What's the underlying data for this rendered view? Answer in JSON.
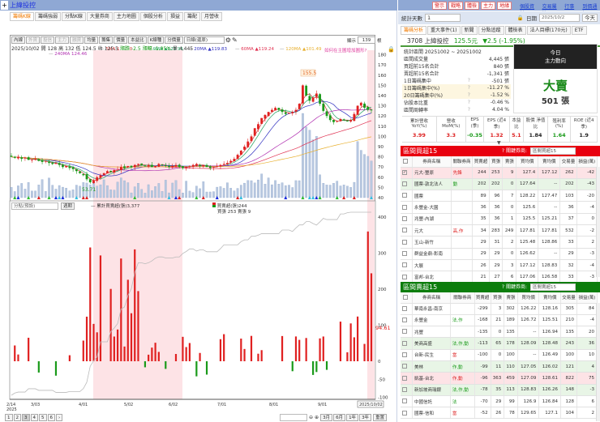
{
  "left": {
    "title": "上緯投控",
    "plus": "+",
    "tabs": [
      "籌碼K線",
      "籌碼強弱",
      "分點K線",
      "大量券商",
      "主力地圖",
      "個股分析",
      "損益",
      "籌配",
      "月營收"
    ],
    "ma": [
      {
        "label": "5MA 130.20",
        "color": "#d03030"
      },
      {
        "label": "10MA ▲123.95",
        "color": "#20a060"
      },
      {
        "label": "20MA ▲119.83",
        "color": "#3030c0"
      },
      {
        "label": "60MA ▲119.24",
        "color": "#e03050"
      },
      {
        "label": "120MA ▲101.49",
        "color": "#e8b030"
      },
      {
        "label": "240MA 124.46",
        "color": "#b030b0"
      }
    ],
    "ma_help": "如何在主圖增加圖形?",
    "toolbar": [
      "內線",
      "外資",
      "投信",
      "主力",
      "融資",
      "均量",
      "籌集",
      "價量",
      "本益比",
      "K線種",
      "分價量"
    ],
    "period_select": "日線(還原)",
    "show_label": "顯示",
    "show_count": "139",
    "show_unit": "根",
    "info": {
      "date": "2025/10/02",
      "open_l": "開",
      "open": "128",
      "high_l": "高",
      "high": "132",
      "low_l": "低",
      "low": "124.5",
      "close_l": "收",
      "close": "125.5",
      "chg_l": "漲跌",
      "chg": "-2.5",
      "pct_l": "漲幅",
      "pct": "-1.95%",
      "vol_l": "量",
      "vol": "4,445"
    },
    "lower": {
      "select": "分點(預設)",
      "button": "週期",
      "cum_legend": "累計買賣超(張)3,377",
      "net_legend": "買賣超(張)244",
      "bs_legend": "買張 253 賣張 9",
      "value_tag": "94.61"
    },
    "xaxis": [
      "2/14",
      "2025",
      "3/03",
      "4/01",
      "5/02",
      "6/02",
      "7/01",
      "8/01",
      "9/01",
      "2025/10/02"
    ],
    "pages": [
      "1",
      "2",
      "3",
      "4",
      "5",
      "6",
      "›"
    ],
    "range_buttons": [
      "3月",
      "6月",
      "1年",
      "3年"
    ],
    "reset": "重置"
  },
  "chart_data": {
    "type": "candlestick",
    "price_ticks": [
      180,
      170,
      160,
      150,
      140,
      130,
      120,
      110,
      100,
      90,
      80,
      70,
      60,
      50,
      40
    ],
    "flow_ticks": [
      400,
      300,
      200,
      100,
      0,
      -50,
      -100
    ],
    "close": [
      80,
      79,
      80,
      78,
      79,
      77,
      77,
      78,
      76,
      75,
      76,
      74,
      73,
      74,
      72,
      70,
      71,
      69,
      68,
      66,
      64,
      62,
      58,
      55,
      57,
      60,
      62,
      64,
      66,
      65,
      67,
      68,
      70,
      69,
      71,
      70,
      72,
      73,
      72,
      71,
      72,
      70,
      71,
      73,
      72,
      71,
      70,
      71,
      72,
      70,
      69,
      70,
      71,
      72,
      73,
      71,
      72,
      70,
      69,
      70,
      71,
      72,
      73,
      74,
      76,
      78,
      82,
      86,
      90,
      95,
      100,
      108,
      112,
      118,
      121,
      124,
      126,
      128,
      126,
      124,
      122,
      123,
      124,
      126,
      132,
      150,
      140,
      135,
      138,
      142,
      132,
      125,
      120,
      116,
      114,
      115,
      117,
      116,
      115,
      116,
      122,
      130,
      133,
      128,
      126,
      125.5
    ],
    "low_label": "53.71",
    "high_label": "155.5"
  },
  "right": {
    "top_buttons": [
      "警示",
      "戰略",
      "體檢",
      "主力",
      "地緣"
    ],
    "top_links": [
      "個股資料",
      "交易屬性",
      "行事曆",
      "到價通知"
    ],
    "days_label": "統計天數",
    "days_value": "1",
    "date_label": "日期",
    "date_value": "2025/10/2",
    "today": "今天",
    "tabs": [
      "籌碼分析",
      "重大事件(1)",
      "新聞",
      "分點追蹤",
      "體檢表",
      "法人目標(170元)",
      "ETF"
    ],
    "stock": {
      "code_name": "3708 上緯投控",
      "price": "125.5元",
      "change": "▼2.5 (-1.95%)"
    },
    "stats": [
      [
        "統計區間  20251002 ~ 20251002",
        "",
        ""
      ],
      [
        "區間成交量",
        "4,445 張",
        ""
      ],
      [
        "買超前15名合計",
        "840 張",
        ""
      ],
      [
        "賣超前15名合計",
        "-1,341 張",
        ""
      ],
      [
        "1日籌碼集中",
        "-501 張",
        "?"
      ],
      [
        "1日籌碼集中(%)",
        "-11.27 %",
        "?"
      ],
      [
        "20日籌碼集中(%)",
        "-1.52 %",
        "?"
      ],
      [
        "佔股本比重",
        "-0.46 %",
        "?"
      ],
      [
        "區間周轉率",
        "4.04 %",
        "?"
      ]
    ],
    "today_box": {
      "l1": "今日",
      "l2": "主力動向",
      "action": "大賣",
      "amount": "501 張"
    },
    "fin_headers": [
      "累計營收 YoY(%)",
      "營收 MoM(%)",
      "EPS (季)",
      "EPS (近4季)",
      "本益比",
      "股價 淨值比",
      "殖利率 (%)",
      "ROE (近4季)"
    ],
    "fin_values": [
      {
        "v": "3.99",
        "c": "#d22"
      },
      {
        "v": "3.3",
        "c": "#d22"
      },
      {
        "v": "-0.35",
        "c": "#1a9a1a"
      },
      {
        "v": "1.32",
        "c": "#d22"
      },
      {
        "v": "5.1",
        "c": "#d22"
      },
      {
        "v": "1.84",
        "c": "#222"
      },
      {
        "v": "1.64",
        "c": "#1a9a1a"
      },
      {
        "v": "1.9",
        "c": "#222"
      }
    ],
    "col_headers": [
      "券商名稱",
      "關聯券商",
      "買賣超",
      "買張",
      "賣張",
      "買均價",
      "賣均價",
      "交易量",
      "損益(萬)"
    ],
    "buy": {
      "title": "區間買超15",
      "filter_label": "關鍵券商:",
      "filter": "區間買超15",
      "rows": [
        {
          "n": "元大-豐原",
          "t": "先鋒",
          "tc": "#d22",
          "v": [
            "244",
            "253",
            "9",
            "127.4",
            "127.12",
            "262",
            "-42"
          ],
          "cls": "tr-pink",
          "checked": "✓"
        },
        {
          "n": "國票-敦北法人",
          "t": "動",
          "tc": "#1a9a1a",
          "v": [
            "202",
            "202",
            "0",
            "127.64",
            "--",
            "202",
            "-43"
          ],
          "cls": "tr-green",
          "checked": ""
        },
        {
          "n": "國票",
          "t": "",
          "tc": "",
          "v": [
            "89",
            "96",
            "7",
            "128.22",
            "127.47",
            "103",
            "-20"
          ],
          "cls": "",
          "checked": ""
        },
        {
          "n": "永豐金-大園",
          "t": "",
          "tc": "",
          "v": [
            "36",
            "36",
            "0",
            "125.6",
            "--",
            "36",
            "-4"
          ],
          "cls": "",
          "checked": ""
        },
        {
          "n": "兆豐-內湖",
          "t": "",
          "tc": "",
          "v": [
            "35",
            "36",
            "1",
            "125.5",
            "125.21",
            "37",
            "0"
          ],
          "cls": "",
          "checked": ""
        },
        {
          "n": "元大",
          "t": "高,作",
          "tc": "#d22",
          "v": [
            "34",
            "283",
            "249",
            "127.81",
            "127.81",
            "532",
            "-2"
          ],
          "cls": "",
          "checked": ""
        },
        {
          "n": "玉山-新竹",
          "t": "",
          "tc": "",
          "v": [
            "29",
            "31",
            "2",
            "125.48",
            "128.86",
            "33",
            "2"
          ],
          "cls": "",
          "checked": ""
        },
        {
          "n": "群益金鼎-彰南",
          "t": "",
          "tc": "",
          "v": [
            "29",
            "29",
            "0",
            "126.62",
            "--",
            "29",
            "-3"
          ],
          "cls": "",
          "checked": ""
        },
        {
          "n": "大展",
          "t": "",
          "tc": "",
          "v": [
            "26",
            "29",
            "3",
            "127.12",
            "128.83",
            "32",
            "-4"
          ],
          "cls": "",
          "checked": ""
        },
        {
          "n": "富邦-台北",
          "t": "",
          "tc": "",
          "v": [
            "21",
            "27",
            "6",
            "127.06",
            "126.58",
            "33",
            "-3"
          ],
          "cls": "",
          "checked": ""
        }
      ]
    },
    "sell": {
      "title": "區間賣超15",
      "filter_label": "關鍵券商:",
      "filter": "區間賣超15",
      "rows": [
        {
          "n": "華南永昌-南京",
          "t": "",
          "tc": "",
          "v": [
            "-299",
            "3",
            "302",
            "126.22",
            "128.16",
            "305",
            "84"
          ],
          "cls": "",
          "checked": ""
        },
        {
          "n": "永豐金",
          "t": "法,作",
          "tc": "#1a9a1a",
          "v": [
            "-168",
            "21",
            "189",
            "126.72",
            "125.51",
            "210",
            "-4"
          ],
          "cls": "",
          "checked": ""
        },
        {
          "n": "兆豐",
          "t": "",
          "tc": "",
          "v": [
            "-135",
            "0",
            "135",
            "--",
            "126.94",
            "135",
            "20"
          ],
          "cls": "",
          "checked": ""
        },
        {
          "n": "美商高盛",
          "t": "法,作,動",
          "tc": "#1a9a1a",
          "v": [
            "-113",
            "65",
            "178",
            "128.09",
            "128.48",
            "243",
            "36"
          ],
          "cls": "tr-green",
          "checked": ""
        },
        {
          "n": "台新-民生",
          "t": "當",
          "tc": "#d22",
          "v": [
            "-100",
            "0",
            "100",
            "--",
            "126.49",
            "100",
            "10"
          ],
          "cls": "",
          "checked": ""
        },
        {
          "n": "美林",
          "t": "作,動",
          "tc": "#1a9a1a",
          "v": [
            "-99",
            "11",
            "110",
            "127.05",
            "126.02",
            "121",
            "4"
          ],
          "cls": "tr-green",
          "checked": ""
        },
        {
          "n": "凱基-台北",
          "t": "作,動",
          "tc": "#d22",
          "v": [
            "-96",
            "363",
            "459",
            "127.09",
            "128.61",
            "822",
            "75"
          ],
          "cls": "tr-pink",
          "checked": ""
        },
        {
          "n": "新加坡商瑞銀",
          "t": "法,作,動",
          "tc": "#1a9a1a",
          "v": [
            "-78",
            "35",
            "113",
            "128.83",
            "126.26",
            "148",
            "-3"
          ],
          "cls": "tr-green",
          "checked": ""
        },
        {
          "n": "中國信託",
          "t": "法",
          "tc": "#1a9a1a",
          "v": [
            "-70",
            "29",
            "99",
            "126.9",
            "126.84",
            "128",
            "6"
          ],
          "cls": "",
          "checked": ""
        },
        {
          "n": "國票-信和",
          "t": "當",
          "tc": "#d22",
          "v": [
            "-52",
            "26",
            "78",
            "129.65",
            "127.1",
            "104",
            "2"
          ],
          "cls": "",
          "checked": ""
        }
      ]
    }
  },
  "colors": {
    "up": "#e02020",
    "down": "#1a9a1a",
    "shade": "#fde3e6",
    "buy_header": "#e8000f",
    "sell_header": "#0c7d0c"
  }
}
